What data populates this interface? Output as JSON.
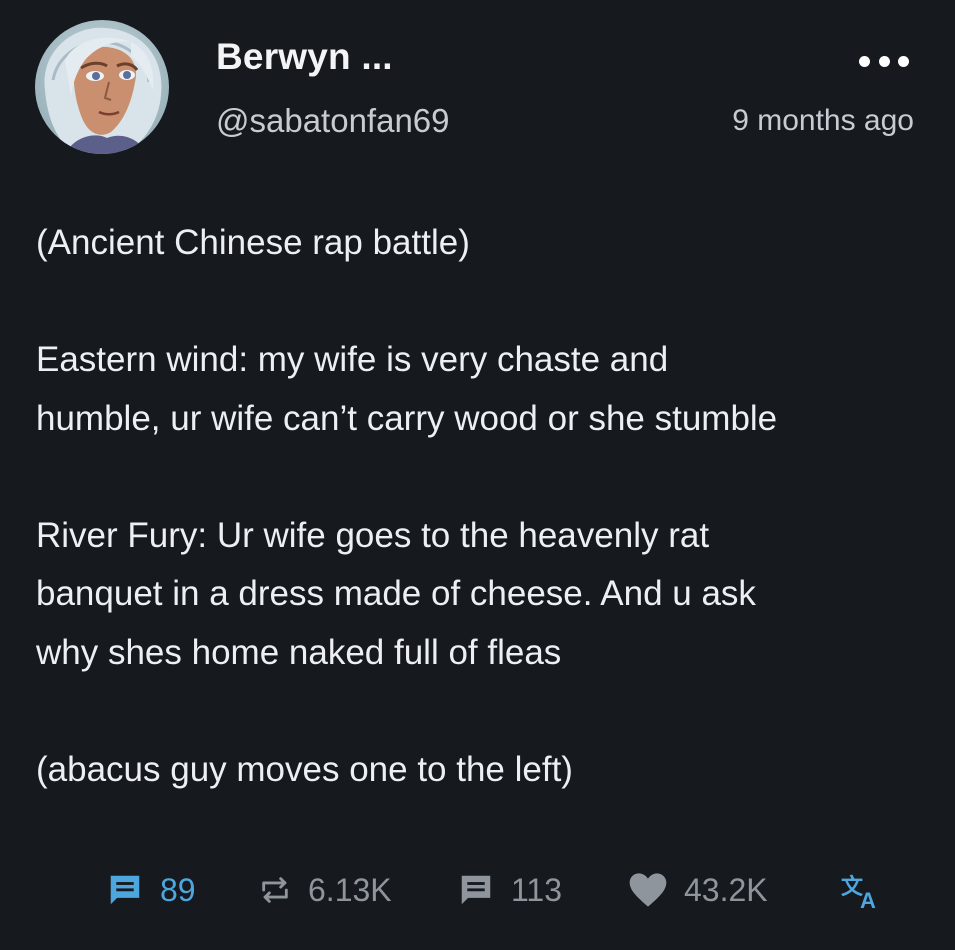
{
  "author": {
    "display_name": "Berwyn ...",
    "handle": "@sabatonfan69",
    "avatar_icon": "anime-character-avatar"
  },
  "timestamp": "9 months ago",
  "menu": {
    "icon": "more-horizontal-icon"
  },
  "post": {
    "paragraphs": [
      {
        "lines": [
          "(Ancient Chinese rap battle)"
        ]
      },
      {
        "lines": [
          "Eastern wind: my wife is very chaste and",
          "humble, ur wife can’t carry wood or she stumble"
        ]
      },
      {
        "lines": [
          "River Fury: Ur wife goes to the heavenly rat",
          "banquet in a dress made of cheese. And u ask",
          "why shes home naked full of fleas"
        ]
      },
      {
        "lines": [
          "(abacus guy moves one to the left)"
        ]
      }
    ]
  },
  "actions": {
    "replies": {
      "count": "89",
      "icon": "reply-icon",
      "color": "#4ea6df"
    },
    "reposts": {
      "count": "6.13K",
      "icon": "repost-icon",
      "color": "#8f959c"
    },
    "quotes": {
      "count": "113",
      "icon": "quote-icon",
      "color": "#8f959c"
    },
    "likes": {
      "count": "43.2K",
      "icon": "heart-icon",
      "color": "#8f959c"
    },
    "translate": {
      "icon": "translate-icon",
      "color": "#4ea6df"
    }
  },
  "colors": {
    "background": "#16191d",
    "text": "#eceff3",
    "muted": "#8f959c",
    "accent": "#4ea6df"
  }
}
